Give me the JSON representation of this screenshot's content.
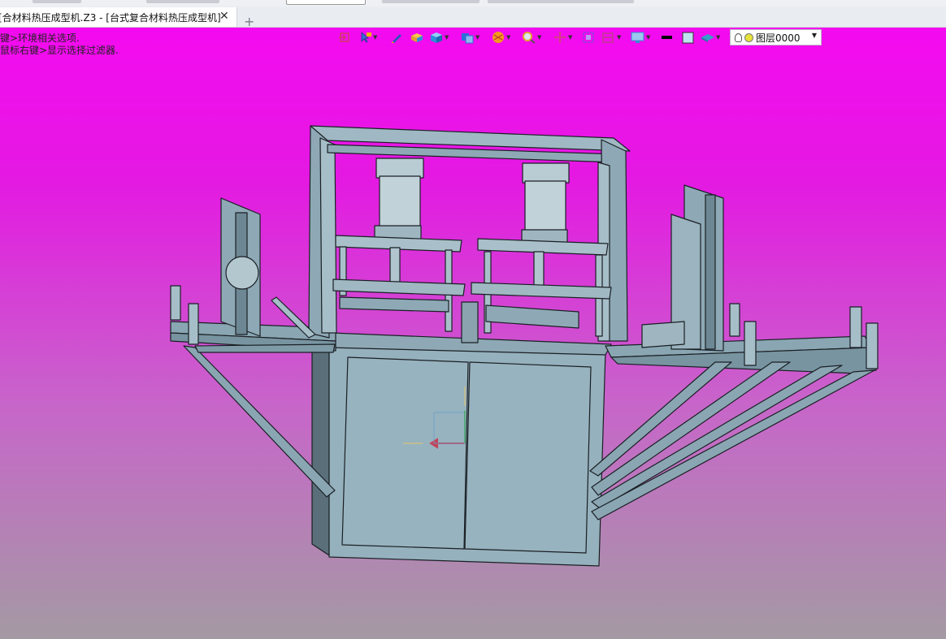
{
  "document": {
    "tab_title": "[合材料热压成型机.Z3 - [台式复合材料热压成型机]",
    "close_glyph": "✕",
    "new_tab_glyph": "+"
  },
  "viewport": {
    "hints": [
      "键>环境相关选项.",
      "鼠标右键>显示选择过滤器."
    ],
    "background_top": "#f40af0",
    "background_bottom": "#a49aa3"
  },
  "toolbar": {
    "items": [
      {
        "icon": "exit-icon",
        "color": "#d33a6b"
      },
      {
        "icon": "pick-filter-icon",
        "color": "#3a6bd3"
      },
      {
        "icon": "pen-icon",
        "color": "#2c56b8"
      },
      {
        "icon": "box-icon",
        "color": "#e0a030"
      },
      {
        "icon": "cube-icon",
        "color": "#2d8fd8"
      },
      {
        "icon": "view-cube-icon",
        "color": "#2d6fd8"
      },
      {
        "icon": "render-mode-icon",
        "color": "#f39a1e"
      },
      {
        "icon": "zoom-icon",
        "color": "#e3a72c"
      },
      {
        "icon": "pan-icon",
        "color": "#d83a8a"
      },
      {
        "icon": "fit-view-icon",
        "color": "#7a4bd6"
      },
      {
        "icon": "section-icon",
        "color": "#c03a8a"
      },
      {
        "icon": "display-icon",
        "color": "#3a8ad3"
      },
      {
        "icon": "line-color-icon",
        "color": "#000000"
      },
      {
        "icon": "face-color-icon",
        "color": "#bfe3f0"
      },
      {
        "icon": "material-icon",
        "color": "#35a0c8"
      }
    ],
    "layer": {
      "name": "图层0000"
    }
  },
  "colors": {
    "machine_fill": "#95b1bd",
    "machine_dark": "#5a6f79",
    "machine_edge": "#1a1f24",
    "cylinder": "#c2d2d9"
  }
}
